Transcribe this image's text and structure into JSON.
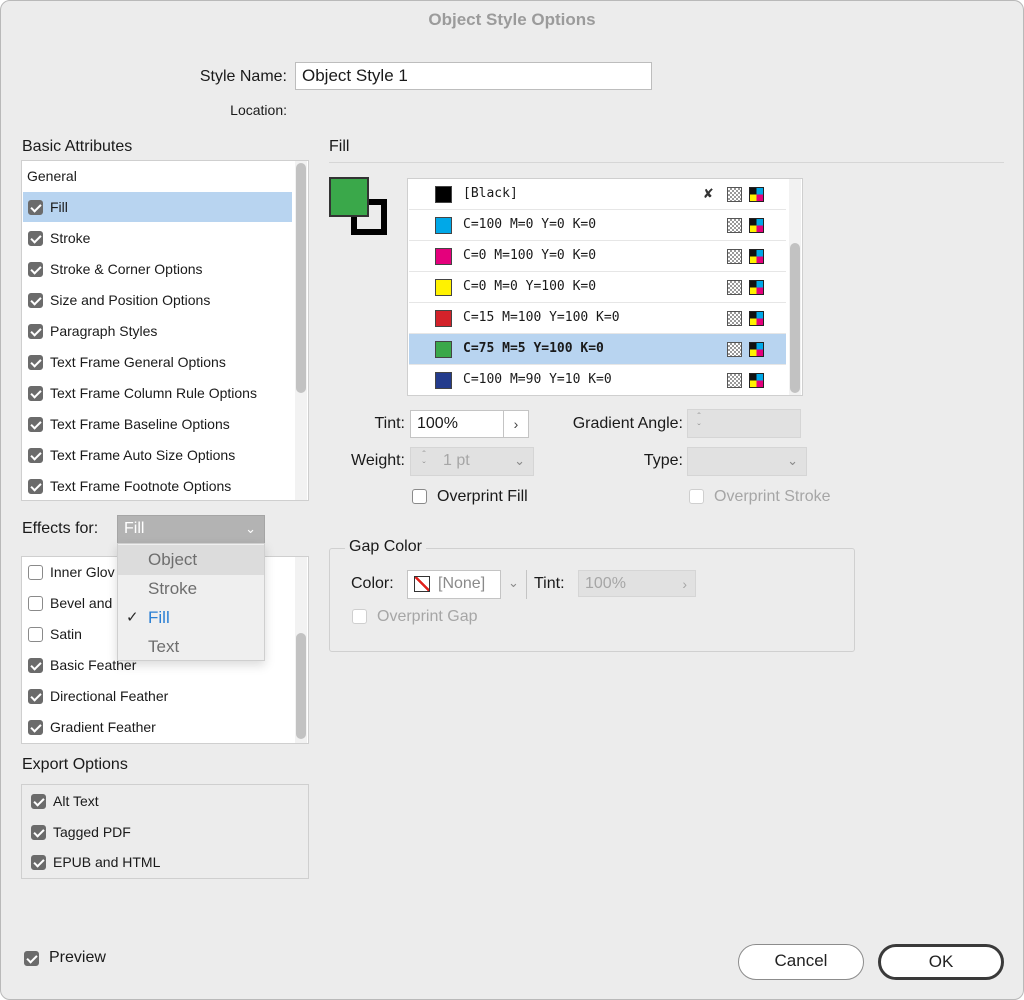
{
  "window": {
    "title": "Object Style Options"
  },
  "style": {
    "name_label": "Style Name:",
    "name_value": "Object Style 1",
    "location_label": "Location:"
  },
  "basic": {
    "title": "Basic Attributes",
    "items": [
      {
        "label": "General"
      },
      {
        "label": "Fill",
        "checked": true
      },
      {
        "label": "Stroke",
        "checked": true
      },
      {
        "label": "Stroke & Corner Options",
        "checked": true
      },
      {
        "label": "Size and Position Options",
        "checked": true
      },
      {
        "label": "Paragraph Styles",
        "checked": true
      },
      {
        "label": "Text Frame General Options",
        "checked": true
      },
      {
        "label": "Text Frame Column Rule Options",
        "checked": true
      },
      {
        "label": "Text Frame Baseline Options",
        "checked": true
      },
      {
        "label": "Text Frame Auto Size Options",
        "checked": true
      },
      {
        "label": "Text Frame Footnote Options",
        "checked": true
      }
    ]
  },
  "effects": {
    "label": "Effects for:",
    "selected": "Fill",
    "options": [
      "Object",
      "Stroke",
      "Fill",
      "Text"
    ],
    "items": [
      {
        "label": "Inner Glow",
        "checked": false
      },
      {
        "label": "Bevel and Emboss",
        "checked": false
      },
      {
        "label": "Satin",
        "checked": false
      },
      {
        "label": "Basic Feather",
        "checked": true
      },
      {
        "label": "Directional Feather",
        "checked": true
      },
      {
        "label": "Gradient Feather",
        "checked": true
      }
    ],
    "visible": [
      "Inner Glov",
      "Bevel and",
      "Satin",
      "Basic Feather",
      "Directional Feather",
      "Gradient Feather"
    ]
  },
  "export": {
    "title": "Export Options",
    "items": [
      {
        "label": "Alt Text",
        "checked": true
      },
      {
        "label": "Tagged PDF",
        "checked": true
      },
      {
        "label": "EPUB and HTML",
        "checked": true
      }
    ]
  },
  "fill": {
    "title": "Fill",
    "fill_color": "#3aa84a",
    "swatches": [
      {
        "name": "[Black]",
        "color": "#000000"
      },
      {
        "name": "C=100 M=0 Y=0 K=0",
        "color": "#00a8e8"
      },
      {
        "name": "C=0 M=100 Y=0 K=0",
        "color": "#e4007c"
      },
      {
        "name": "C=0 M=0 Y=100 K=0",
        "color": "#fff200"
      },
      {
        "name": "C=15 M=100 Y=100 K=0",
        "color": "#d3222a"
      },
      {
        "name": "C=75 M=5 Y=100 K=0",
        "color": "#3aa84a"
      },
      {
        "name": "C=100 M=90 Y=10 K=0",
        "color": "#233b8c"
      }
    ],
    "tint_label": "Tint:",
    "tint_value": "100%",
    "gradient_angle_label": "Gradient Angle:",
    "weight_label": "Weight:",
    "weight_value": "1 pt",
    "type_label": "Type:",
    "overprint_fill": "Overprint Fill",
    "overprint_stroke": "Overprint Stroke"
  },
  "gap": {
    "title": "Gap Color",
    "color_label": "Color:",
    "color_value": "[None]",
    "tint_label": "Tint:",
    "tint_value": "100%",
    "overprint_gap": "Overprint Gap"
  },
  "footer": {
    "preview": "Preview",
    "cancel": "Cancel",
    "ok": "OK"
  }
}
